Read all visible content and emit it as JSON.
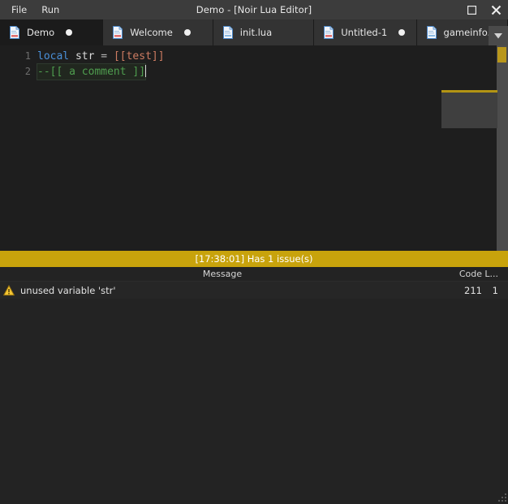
{
  "window": {
    "title": "Demo - [Noir Lua Editor]",
    "menus": [
      {
        "label": "File",
        "name": "menu-file"
      },
      {
        "label": "Run",
        "name": "menu-run"
      }
    ],
    "buttons": {
      "maximize": "maximize-icon",
      "close": "close-icon"
    }
  },
  "tabs": {
    "items": [
      {
        "label": "Demo",
        "icon": "document-icon",
        "active": true,
        "modified": true
      },
      {
        "label": "Welcome",
        "icon": "document-icon",
        "active": false,
        "modified": true
      },
      {
        "label": "init.lua",
        "icon": "document-icon",
        "active": false,
        "modified": false
      },
      {
        "label": "Untitled-1",
        "icon": "document-icon",
        "active": false,
        "modified": true
      },
      {
        "label": "gameinfo.",
        "icon": "document-icon",
        "active": false,
        "modified": false
      }
    ],
    "overflow_icon": "chevron-down-icon"
  },
  "editor": {
    "lines": [
      {
        "number": "1",
        "tokens": [
          {
            "text": "local",
            "type": "keyword"
          },
          {
            "text": " ",
            "type": "plain"
          },
          {
            "text": "str",
            "type": "variable-warning"
          },
          {
            "text": " ",
            "type": "plain"
          },
          {
            "text": "=",
            "type": "operator"
          },
          {
            "text": " ",
            "type": "plain"
          },
          {
            "text": "[[test]]",
            "type": "string"
          }
        ]
      },
      {
        "number": "2",
        "tokens": [
          {
            "text": "--[[ a comment ]]",
            "type": "comment-selected"
          }
        ]
      }
    ]
  },
  "status": {
    "text": "[17:38:01] Has 1 issue(s)",
    "background": "#c8a30c",
    "foreground": "#ffffff"
  },
  "issues": {
    "columns": [
      {
        "key": "message",
        "label": "Message"
      },
      {
        "key": "code",
        "label": "Code"
      },
      {
        "key": "line",
        "label": "L..."
      }
    ],
    "rows": [
      {
        "severity": "warning-icon",
        "message": "unused variable 'str'",
        "code": "211",
        "line": "1"
      }
    ]
  },
  "colors": {
    "titlebar": "#3c3c3c",
    "tab_active": "#1b1b1b",
    "tab_inactive": "#333333",
    "editor_bg": "#1e1e1e",
    "keyword": "#4a90d9",
    "string": "#cd7c62",
    "comment": "#4f9e4f",
    "warning": "#c8a30c",
    "scrollbar_mark": "#b9971b"
  }
}
